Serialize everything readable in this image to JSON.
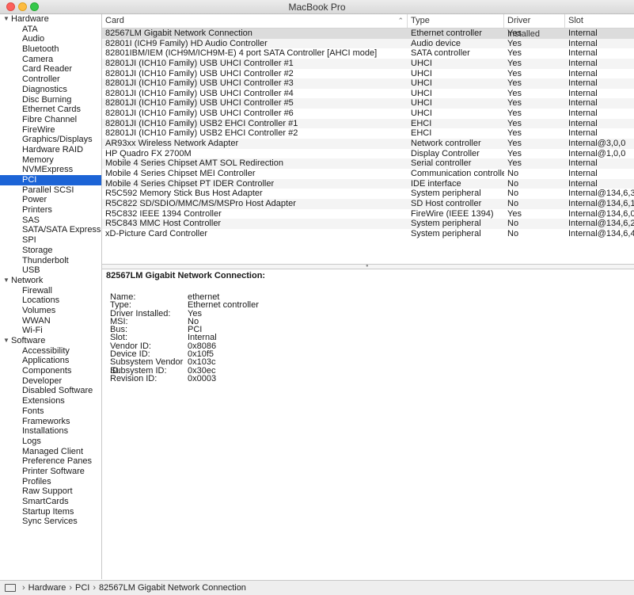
{
  "window": {
    "title": "MacBook Pro"
  },
  "sidebar": {
    "groups": [
      {
        "label": "Hardware",
        "items": [
          "ATA",
          "Audio",
          "Bluetooth",
          "Camera",
          "Card Reader",
          "Controller",
          "Diagnostics",
          "Disc Burning",
          "Ethernet Cards",
          "Fibre Channel",
          "FireWire",
          "Graphics/Displays",
          "Hardware RAID",
          "Memory",
          "NVMExpress",
          "PCI",
          "Parallel SCSI",
          "Power",
          "Printers",
          "SAS",
          "SATA/SATA Express",
          "SPI",
          "Storage",
          "Thunderbolt",
          "USB"
        ]
      },
      {
        "label": "Network",
        "items": [
          "Firewall",
          "Locations",
          "Volumes",
          "WWAN",
          "Wi-Fi"
        ]
      },
      {
        "label": "Software",
        "items": [
          "Accessibility",
          "Applications",
          "Components",
          "Developer",
          "Disabled Software",
          "Extensions",
          "Fonts",
          "Frameworks",
          "Installations",
          "Logs",
          "Managed Client",
          "Preference Panes",
          "Printer Software",
          "Profiles",
          "Raw Support",
          "SmartCards",
          "Startup Items",
          "Sync Services"
        ]
      }
    ],
    "selected": "PCI"
  },
  "table": {
    "columns": [
      "Card",
      "Type",
      "Driver Installed",
      "Slot"
    ],
    "rows": [
      [
        "82567LM Gigabit Network Connection",
        "Ethernet controller",
        "Yes",
        "Internal"
      ],
      [
        "82801I (ICH9 Family) HD Audio Controller",
        "Audio device",
        "Yes",
        "Internal"
      ],
      [
        "82801IBM/IEM (ICH9M/ICH9M-E) 4 port SATA Controller [AHCI mode]",
        "SATA controller",
        "Yes",
        "Internal"
      ],
      [
        "82801JI (ICH10 Family) USB UHCI Controller #1",
        "UHCI",
        "Yes",
        "Internal"
      ],
      [
        "82801JI (ICH10 Family) USB UHCI Controller #2",
        "UHCI",
        "Yes",
        "Internal"
      ],
      [
        "82801JI (ICH10 Family) USB UHCI Controller #3",
        "UHCI",
        "Yes",
        "Internal"
      ],
      [
        "82801JI (ICH10 Family) USB UHCI Controller #4",
        "UHCI",
        "Yes",
        "Internal"
      ],
      [
        "82801JI (ICH10 Family) USB UHCI Controller #5",
        "UHCI",
        "Yes",
        "Internal"
      ],
      [
        "82801JI (ICH10 Family) USB UHCI Controller #6",
        "UHCI",
        "Yes",
        "Internal"
      ],
      [
        "82801JI (ICH10 Family) USB2 EHCI Controller #1",
        "EHCI",
        "Yes",
        "Internal"
      ],
      [
        "82801JI (ICH10 Family) USB2 EHCI Controller #2",
        "EHCI",
        "Yes",
        "Internal"
      ],
      [
        "AR93xx Wireless Network Adapter",
        "Network controller",
        "Yes",
        "Internal@3,0,0"
      ],
      [
        "HP Quadro FX 2700M",
        "Display Controller",
        "Yes",
        "Internal@1,0,0"
      ],
      [
        "Mobile 4 Series Chipset AMT SOL Redirection",
        "Serial controller",
        "Yes",
        "Internal"
      ],
      [
        "Mobile 4 Series Chipset MEI Controller",
        "Communication controller",
        "No",
        "Internal"
      ],
      [
        "Mobile 4 Series Chipset PT IDER Controller",
        "IDE interface",
        "No",
        "Internal"
      ],
      [
        "R5C592 Memory Stick Bus Host Adapter",
        "System peripheral",
        "No",
        "Internal@134,6,3"
      ],
      [
        "R5C822 SD/SDIO/MMC/MS/MSPro Host Adapter",
        "SD Host controller",
        "No",
        "Internal@134,6,1"
      ],
      [
        "R5C832 IEEE 1394 Controller",
        "FireWire (IEEE 1394)",
        "Yes",
        "Internal@134,6,0"
      ],
      [
        "R5C843 MMC Host Controller",
        "System peripheral",
        "No",
        "Internal@134,6,2"
      ],
      [
        "xD-Picture Card Controller",
        "System peripheral",
        "No",
        "Internal@134,6,4"
      ]
    ],
    "selected_row": 0
  },
  "detail": {
    "title": "82567LM Gigabit Network Connection:",
    "properties": [
      [
        "Name:",
        "ethernet"
      ],
      [
        "Type:",
        "Ethernet controller"
      ],
      [
        "Driver Installed:",
        "Yes"
      ],
      [
        "MSI:",
        "No"
      ],
      [
        "Bus:",
        "PCI"
      ],
      [
        "Slot:",
        "Internal"
      ],
      [
        "Vendor ID:",
        "0x8086"
      ],
      [
        "Device ID:",
        "0x10f5"
      ],
      [
        "Subsystem Vendor ID:",
        "0x103c"
      ],
      [
        "Subsystem ID:",
        "0x30ec"
      ],
      [
        "Revision ID:",
        "0x0003"
      ]
    ]
  },
  "pathbar": {
    "crumbs": [
      "Hardware",
      "PCI",
      "82567LM Gigabit Network Connection"
    ]
  },
  "colors": {
    "selection_blue": "#1c64d6",
    "row_selected": "#dcdcdc",
    "stripe": "#f4f4f4"
  }
}
